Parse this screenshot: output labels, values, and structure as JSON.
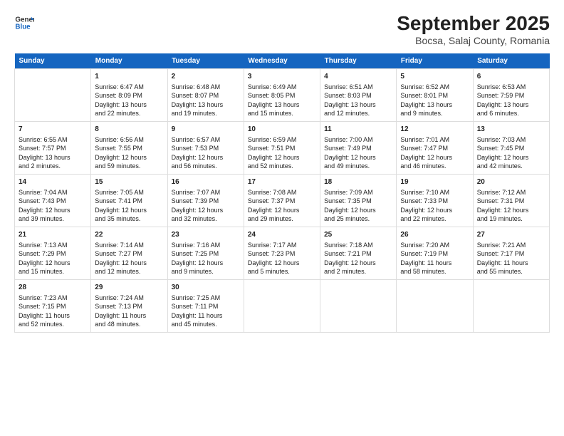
{
  "header": {
    "logo_line1": "General",
    "logo_line2": "Blue",
    "title": "September 2025",
    "subtitle": "Bocsa, Salaj County, Romania"
  },
  "weekdays": [
    "Sunday",
    "Monday",
    "Tuesday",
    "Wednesday",
    "Thursday",
    "Friday",
    "Saturday"
  ],
  "weeks": [
    [
      {
        "day": "",
        "content": ""
      },
      {
        "day": "1",
        "content": "Sunrise: 6:47 AM\nSunset: 8:09 PM\nDaylight: 13 hours\nand 22 minutes."
      },
      {
        "day": "2",
        "content": "Sunrise: 6:48 AM\nSunset: 8:07 PM\nDaylight: 13 hours\nand 19 minutes."
      },
      {
        "day": "3",
        "content": "Sunrise: 6:49 AM\nSunset: 8:05 PM\nDaylight: 13 hours\nand 15 minutes."
      },
      {
        "day": "4",
        "content": "Sunrise: 6:51 AM\nSunset: 8:03 PM\nDaylight: 13 hours\nand 12 minutes."
      },
      {
        "day": "5",
        "content": "Sunrise: 6:52 AM\nSunset: 8:01 PM\nDaylight: 13 hours\nand 9 minutes."
      },
      {
        "day": "6",
        "content": "Sunrise: 6:53 AM\nSunset: 7:59 PM\nDaylight: 13 hours\nand 6 minutes."
      }
    ],
    [
      {
        "day": "7",
        "content": "Sunrise: 6:55 AM\nSunset: 7:57 PM\nDaylight: 13 hours\nand 2 minutes."
      },
      {
        "day": "8",
        "content": "Sunrise: 6:56 AM\nSunset: 7:55 PM\nDaylight: 12 hours\nand 59 minutes."
      },
      {
        "day": "9",
        "content": "Sunrise: 6:57 AM\nSunset: 7:53 PM\nDaylight: 12 hours\nand 56 minutes."
      },
      {
        "day": "10",
        "content": "Sunrise: 6:59 AM\nSunset: 7:51 PM\nDaylight: 12 hours\nand 52 minutes."
      },
      {
        "day": "11",
        "content": "Sunrise: 7:00 AM\nSunset: 7:49 PM\nDaylight: 12 hours\nand 49 minutes."
      },
      {
        "day": "12",
        "content": "Sunrise: 7:01 AM\nSunset: 7:47 PM\nDaylight: 12 hours\nand 46 minutes."
      },
      {
        "day": "13",
        "content": "Sunrise: 7:03 AM\nSunset: 7:45 PM\nDaylight: 12 hours\nand 42 minutes."
      }
    ],
    [
      {
        "day": "14",
        "content": "Sunrise: 7:04 AM\nSunset: 7:43 PM\nDaylight: 12 hours\nand 39 minutes."
      },
      {
        "day": "15",
        "content": "Sunrise: 7:05 AM\nSunset: 7:41 PM\nDaylight: 12 hours\nand 35 minutes."
      },
      {
        "day": "16",
        "content": "Sunrise: 7:07 AM\nSunset: 7:39 PM\nDaylight: 12 hours\nand 32 minutes."
      },
      {
        "day": "17",
        "content": "Sunrise: 7:08 AM\nSunset: 7:37 PM\nDaylight: 12 hours\nand 29 minutes."
      },
      {
        "day": "18",
        "content": "Sunrise: 7:09 AM\nSunset: 7:35 PM\nDaylight: 12 hours\nand 25 minutes."
      },
      {
        "day": "19",
        "content": "Sunrise: 7:10 AM\nSunset: 7:33 PM\nDaylight: 12 hours\nand 22 minutes."
      },
      {
        "day": "20",
        "content": "Sunrise: 7:12 AM\nSunset: 7:31 PM\nDaylight: 12 hours\nand 19 minutes."
      }
    ],
    [
      {
        "day": "21",
        "content": "Sunrise: 7:13 AM\nSunset: 7:29 PM\nDaylight: 12 hours\nand 15 minutes."
      },
      {
        "day": "22",
        "content": "Sunrise: 7:14 AM\nSunset: 7:27 PM\nDaylight: 12 hours\nand 12 minutes."
      },
      {
        "day": "23",
        "content": "Sunrise: 7:16 AM\nSunset: 7:25 PM\nDaylight: 12 hours\nand 9 minutes."
      },
      {
        "day": "24",
        "content": "Sunrise: 7:17 AM\nSunset: 7:23 PM\nDaylight: 12 hours\nand 5 minutes."
      },
      {
        "day": "25",
        "content": "Sunrise: 7:18 AM\nSunset: 7:21 PM\nDaylight: 12 hours\nand 2 minutes."
      },
      {
        "day": "26",
        "content": "Sunrise: 7:20 AM\nSunset: 7:19 PM\nDaylight: 11 hours\nand 58 minutes."
      },
      {
        "day": "27",
        "content": "Sunrise: 7:21 AM\nSunset: 7:17 PM\nDaylight: 11 hours\nand 55 minutes."
      }
    ],
    [
      {
        "day": "28",
        "content": "Sunrise: 7:23 AM\nSunset: 7:15 PM\nDaylight: 11 hours\nand 52 minutes."
      },
      {
        "day": "29",
        "content": "Sunrise: 7:24 AM\nSunset: 7:13 PM\nDaylight: 11 hours\nand 48 minutes."
      },
      {
        "day": "30",
        "content": "Sunrise: 7:25 AM\nSunset: 7:11 PM\nDaylight: 11 hours\nand 45 minutes."
      },
      {
        "day": "",
        "content": ""
      },
      {
        "day": "",
        "content": ""
      },
      {
        "day": "",
        "content": ""
      },
      {
        "day": "",
        "content": ""
      }
    ]
  ]
}
